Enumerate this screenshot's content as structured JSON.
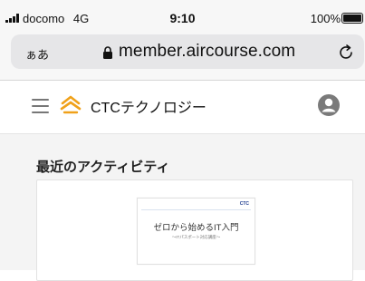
{
  "status_bar": {
    "carrier": "docomo",
    "network": "4G",
    "time": "9:10",
    "battery": "100%"
  },
  "address_bar": {
    "aa_label": "ぁあ",
    "url": "member.aircourse.com",
    "icons": [
      "lock-icon",
      "reload-icon"
    ]
  },
  "header": {
    "brand": "CTCテクノロジー",
    "icons": [
      "hamburger-menu-icon",
      "ctc-logo-icon",
      "account-icon"
    ],
    "brand_color": "#f0a11a"
  },
  "main": {
    "section_title": "最近のアクティビティ",
    "card": {
      "thumbnail_logo": "CTC",
      "thumbnail_title": "ゼロから始めるIT入門",
      "thumbnail_subtitle": "〜ITパスポート対応講座〜"
    }
  },
  "colors": {
    "background": "#f4f4f4",
    "accent": "#f0a11a",
    "thumbnail_logo": "#1d3c8f"
  }
}
